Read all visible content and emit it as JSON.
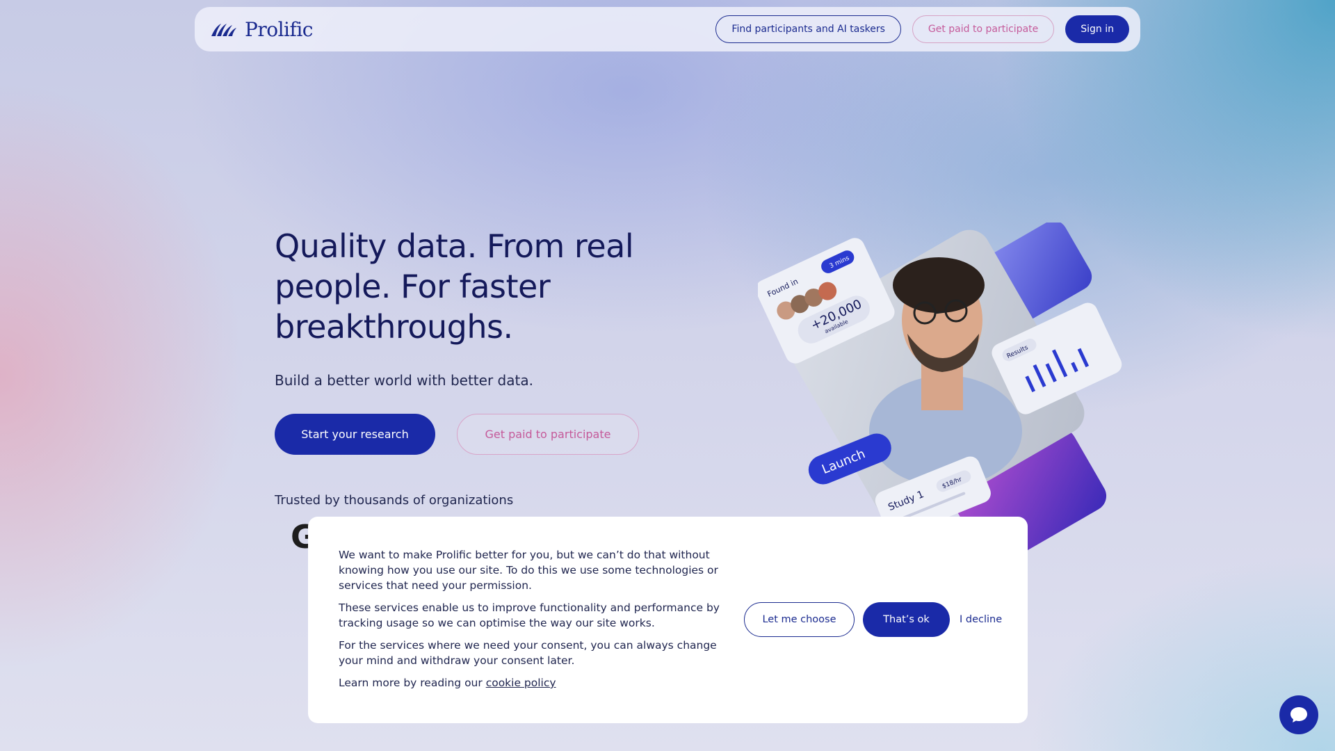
{
  "nav": {
    "logo_text": "Prolific",
    "find_participants": "Find participants and AI taskers",
    "get_paid": "Get paid to participate",
    "sign_in": "Sign in"
  },
  "hero": {
    "title": "Quality data. From real people. For faster breakthroughs.",
    "subtitle": "Build a better world with better data.",
    "start_research": "Start your research",
    "get_paid": "Get paid to participate",
    "trusted": "Trusted by thousands of organizations",
    "partial_logo_letter": "G"
  },
  "illustration": {
    "found_in_label": "Found in",
    "found_in_time": "3 mins",
    "participant_count": "+20,000",
    "available_label": "available",
    "results_label": "Results",
    "launch_label": "Launch",
    "study_label": "Study 1",
    "rate_label": "$18/hr"
  },
  "cookie": {
    "p1": "We want to make Prolific better for you, but we can’t do that without knowing how you use our site. To do this we use some technologies or services that need your permission.",
    "p2": "These services enable us to improve functionality and performance by tracking usage so we can optimise the way our site works.",
    "p3": "For the services where we need your consent, you can always change your mind and withdraw your consent later.",
    "p4_prefix": "Learn more by reading our",
    "p4_link": "cookie policy",
    "let_me_choose": "Let me choose",
    "thats_ok": "That’s ok",
    "decline": "I decline"
  },
  "colors": {
    "brand_blue": "#1a2aa8",
    "navy_text": "#14195a",
    "pink_accent": "#c55a9a"
  }
}
